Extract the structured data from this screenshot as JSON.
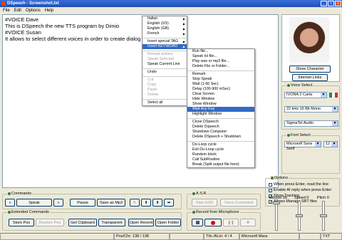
{
  "window": {
    "title": "DSpeech - Screenshot.txt",
    "minimize": "_",
    "maximize": "□",
    "close": "x"
  },
  "menubar": [
    "File",
    "Edit",
    "Options",
    "Help"
  ],
  "editor_lines": [
    "#VOICE Dave",
    "This is DSpeech the new TTS program by Dimio",
    "#VOICE Susan",
    "It allows to select different voices in order to create dialog"
  ],
  "context_menu": [
    {
      "label": "Italian",
      "sub": true
    },
    {
      "label": "English (US)",
      "sub": true
    },
    {
      "label": "English (GB)",
      "sub": true
    },
    {
      "label": "French",
      "sub": true
    },
    {
      "sep": true
    },
    {
      "label": "Insert special TAG",
      "sub": true
    },
    {
      "label": "Insert KEYWORD",
      "sub": true,
      "hl": true
    },
    {
      "sep": true
    },
    {
      "label": "Reread actions",
      "dis": true
    },
    {
      "label": "Speak Selected",
      "dis": true
    },
    {
      "label": "Speak Current Line"
    },
    {
      "sep": true
    },
    {
      "label": "Undo"
    },
    {
      "sep": true
    },
    {
      "label": "Cut",
      "dis": true
    },
    {
      "label": "Copy",
      "dis": true
    },
    {
      "label": "Paste",
      "dis": true
    },
    {
      "label": "Delete",
      "dis": true
    },
    {
      "sep": true
    },
    {
      "label": "Select all"
    }
  ],
  "keyword_menu": [
    {
      "label": "Run file..."
    },
    {
      "label": "Speak txt file..."
    },
    {
      "label": "Play wav or mp3 file..."
    },
    {
      "label": "Delete File or Folder..."
    },
    {
      "sep": true
    },
    {
      "label": "Remark"
    },
    {
      "label": "Stop Speak"
    },
    {
      "label": "Wait (1-60 Sec)"
    },
    {
      "label": "Delay (100-900 mSec)"
    },
    {
      "label": "Clear Screen"
    },
    {
      "label": "Hide Window"
    },
    {
      "label": "Show Window"
    },
    {
      "label": "Wait Any Key",
      "hl": true
    },
    {
      "label": "Highlight Window"
    },
    {
      "sep": true
    },
    {
      "label": "Close DSpeech"
    },
    {
      "label": "Delete Dspeech"
    },
    {
      "label": "Shutdown Computer"
    },
    {
      "label": "Delete DSpeech + Shutdown"
    },
    {
      "sep": true
    },
    {
      "label": "Do-Loop cycle"
    },
    {
      "label": "Exit Do-Loop cycle"
    },
    {
      "label": "Random block"
    },
    {
      "label": "Call SubRoutine"
    },
    {
      "label": "Break (Split output file here)"
    }
  ],
  "right_panel": {
    "show_character": "Show Character",
    "internet_links": "Internet Links",
    "voice_select_label": "Voice Select",
    "voice": "IVONA 2 Carla",
    "audio_format": "22 kHz 16 Bit Mono",
    "audio_device": "SigmaTel Audio",
    "font_select_label": "Font Select",
    "font_name": "Microsoft Sans Serif",
    "font_size": "12",
    "options_label": "Options",
    "options": [
      {
        "label": "When press Enter, read the line",
        "checked": false
      },
      {
        "label": "Enable AI reply when press Enter",
        "checked": false
      },
      {
        "label": "Show Tracking",
        "checked": true
      },
      {
        "label": "Allows Manage SRT files",
        "checked": true
      }
    ],
    "volume_label": "Volume 99",
    "speed_label": "Speed 0",
    "pitch_label": "Pitch 0"
  },
  "sliders": {
    "volume": 0.99,
    "speed": 0.5,
    "pitch": 0.5
  },
  "commands": {
    "label": "Commands",
    "speak": "Speak",
    "pause": "Pause",
    "save_mp3": "Save as Mp3",
    "prev": "«",
    "next": "»"
  },
  "asr": {
    "label": "A.S.R.",
    "start": "Start ASR",
    "voice_command": "Voice Command"
  },
  "extended": {
    "label": "Extended Commands",
    "store_pos": "Store Pos",
    "restore_pos": "Restore Pos",
    "get_clipboard": "Get Clipboard",
    "transparent": "Transparent",
    "open_recent": "Open Recent",
    "open_folder": "Open Folder"
  },
  "record": {
    "label": "Record from Microphone"
  },
  "status": {
    "pos": "Pos/Chr: 138 / 138",
    "line": "Tlin /ALin: 4 / 4",
    "voice": "Microsoft Mara",
    "ext": "TXT"
  }
}
